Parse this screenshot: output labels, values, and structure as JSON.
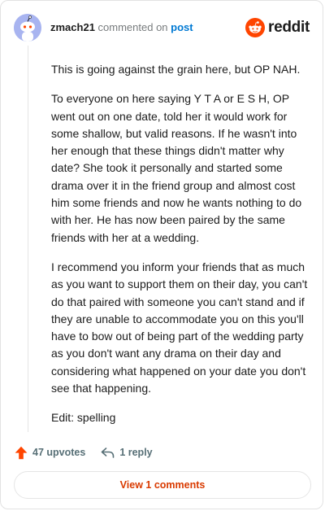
{
  "comment": {
    "author": "zmach21",
    "action_text": "commented on",
    "target_link": "post",
    "brand": "reddit",
    "paragraphs": [
      "This is going against the grain here, but OP NAH.",
      "To everyone on here saying Y T A or E S H, OP went out on one date, told her it would work for some shallow, but valid reasons. If he wasn't into her enough that these things didn't matter why date? She took it personally and started some drama over it in the friend group and almost cost him some friends and now he wants nothing to do with her. He has now been paired by the same friends with her at a wedding.",
      "I recommend you inform your friends that as much as you want to support them on their day, you can't do that paired with someone you can't stand and if they are unable to accommodate you on this you'll have to bow out of being part of the wedding party as you don't want any drama on their day and considering what happened on your date you don't see that happening.",
      "Edit: spelling"
    ]
  },
  "actions": {
    "upvotes_label": "47 upvotes",
    "reply_label": "1 reply",
    "view_comments_label": "View 1 comments"
  },
  "colors": {
    "brand_orange": "#ff4500",
    "link_blue": "#0079d3",
    "view_button_text": "#d93a00",
    "avatar_bg": "#a8b4f0"
  },
  "icons": {
    "avatar": "snoo-avatar",
    "logo": "reddit-snoo-logo",
    "upvote": "upvote-arrow-icon",
    "reply": "reply-arrow-icon"
  }
}
